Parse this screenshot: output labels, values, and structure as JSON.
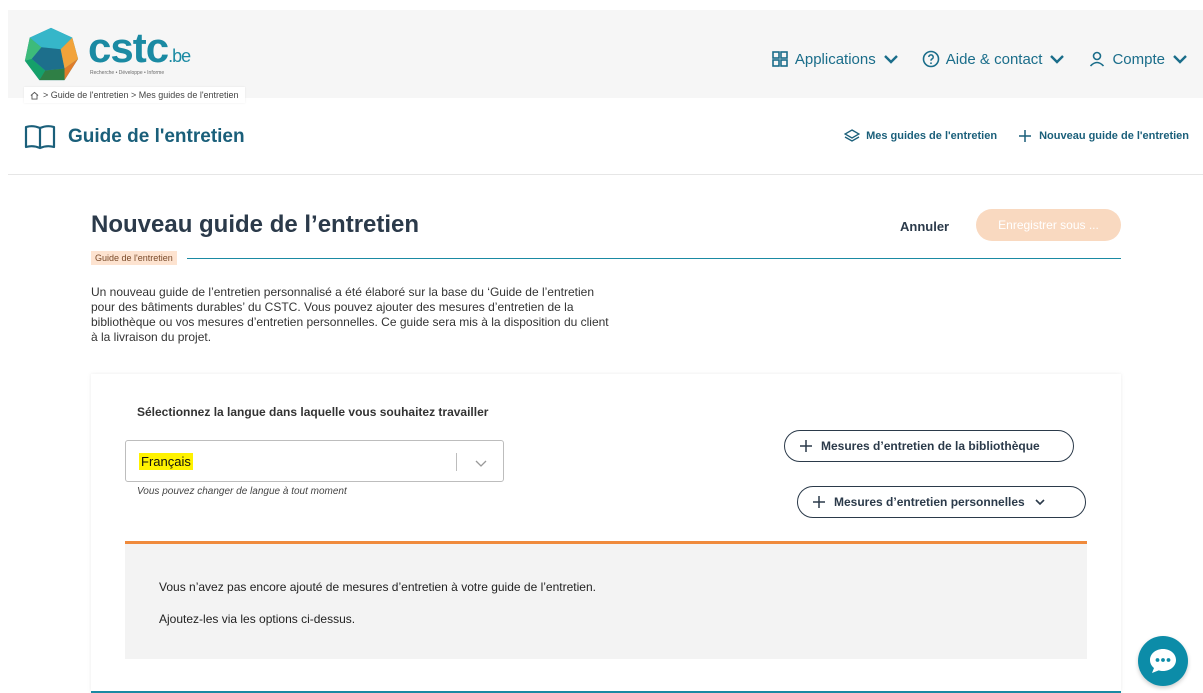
{
  "logo": {
    "name": "cstc",
    "suffix": ".be",
    "tagline": "Recherche • Développe • Informe"
  },
  "breadcrumb": {
    "path": "> Guide de l'entretien > Mes guides de l'entretien"
  },
  "topnav": {
    "applications": "Applications",
    "help": "Aide & contact",
    "account": "Compte"
  },
  "module": {
    "title": "Guide de l'entretien",
    "my_guides": "Mes guides de l'entretien",
    "new_guide": "Nouveau guide de l'entretien"
  },
  "page": {
    "title": "Nouveau guide de l’entretien",
    "cancel": "Annuler",
    "save": "Enregistrer sous ...",
    "tag": "Guide de l'entretien",
    "intro": "Un nouveau guide de l’entretien personnalisé a été élaboré sur la base du ‘Guide de l’entretien pour des bâtiments durables’ du CSTC. Vous pouvez ajouter des mesures d’entretien de la bibliothèque ou vos mesures d’entretien personnelles. Ce guide sera mis à la disposition du client à la livraison du projet."
  },
  "card": {
    "lang_label": "Sélectionnez la langue dans laquelle vous souhaitez travailler",
    "lang_value": "Français",
    "lang_hint": "Vous pouvez changer de langue à tout moment",
    "btn_library": "Mesures d’entretien de la bibliothèque",
    "btn_personal": "Mesures d’entretien personnelles",
    "empty_line1": "Vous n’avez pas encore ajouté de mesures d’entretien à votre guide de l’entretien.",
    "empty_line2": "Ajoutez-les via les options ci-dessus."
  },
  "colors": {
    "brand": "#1a8aa3",
    "navy": "#1a5f7a",
    "accent_orange": "#ef8a3c",
    "save_disabled": "#f9d9c0",
    "highlight": "#fff200"
  }
}
